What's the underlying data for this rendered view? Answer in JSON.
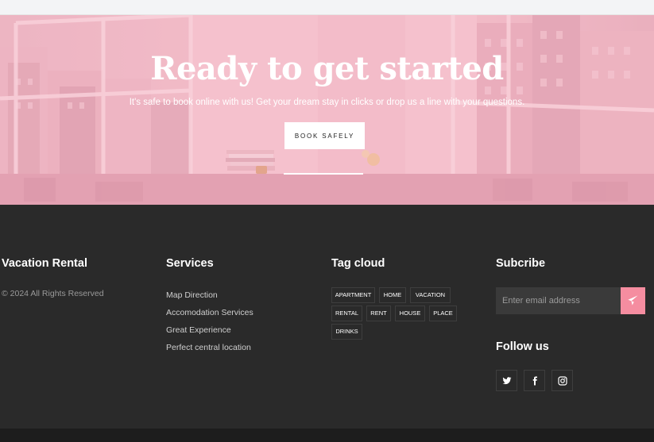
{
  "hero": {
    "title": "Ready to get started",
    "subtitle": "It's safe to book online with us! Get your dream stay in clicks or drop us a line with your questions.",
    "button_label": "BOOK SAFELY"
  },
  "footer": {
    "brand": {
      "title": "Vacation Rental",
      "copyright": "© 2024 All Rights Reserved"
    },
    "services": {
      "title": "Services",
      "items": [
        "Map Direction",
        "Accomodation Services",
        "Great Experience",
        "Perfect central location"
      ]
    },
    "tags": {
      "title": "Tag cloud",
      "items": [
        "APARTMENT",
        "HOME",
        "VACATION",
        "RENTAL",
        "RENT",
        "HOUSE",
        "PLACE",
        "DRINKS"
      ]
    },
    "subscribe": {
      "title": "Subcribe",
      "email_placeholder": "Enter email address",
      "accent_color": "#f58da0"
    },
    "follow": {
      "title": "Follow us",
      "icons": [
        "twitter-icon",
        "facebook-icon",
        "instagram-icon"
      ]
    }
  }
}
